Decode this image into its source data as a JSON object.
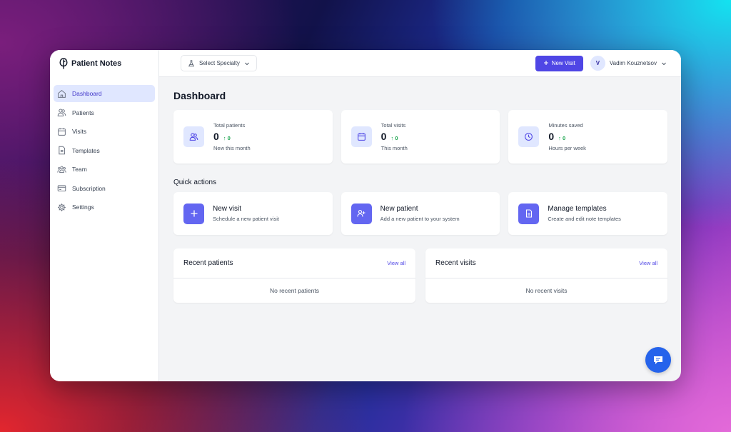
{
  "app": {
    "name": "Patient Notes",
    "accent": "#4f46e5"
  },
  "sidebar": {
    "items": [
      {
        "label": "Dashboard",
        "icon": "home-icon",
        "active": true
      },
      {
        "label": "Patients",
        "icon": "users-icon"
      },
      {
        "label": "Visits",
        "icon": "calendar-icon"
      },
      {
        "label": "Templates",
        "icon": "file-icon"
      },
      {
        "label": "Team",
        "icon": "team-icon"
      },
      {
        "label": "Subscription",
        "icon": "credit-card-icon"
      },
      {
        "label": "Settings",
        "icon": "gear-icon"
      }
    ]
  },
  "topbar": {
    "specialty_label": "Select Specialty",
    "new_visit_label": "New Visit",
    "user": {
      "initial": "V",
      "name": "Vadim Kouznetsov"
    }
  },
  "dashboard": {
    "title": "Dashboard",
    "stats": [
      {
        "label": "Total patients",
        "value": "0",
        "delta": "0",
        "sub": "New this month",
        "icon": "users-icon"
      },
      {
        "label": "Total visits",
        "value": "0",
        "delta": "0",
        "sub": "This month",
        "icon": "calendar-icon"
      },
      {
        "label": "Minutes saved",
        "value": "0",
        "delta": "0",
        "sub": "Hours per week",
        "icon": "clock-icon"
      }
    ],
    "quick_actions_title": "Quick actions",
    "quick_actions": [
      {
        "title": "New visit",
        "desc": "Schedule a new patient visit",
        "icon": "plus-icon"
      },
      {
        "title": "New patient",
        "desc": "Add a new patient to your system",
        "icon": "user-plus-icon"
      },
      {
        "title": "Manage templates",
        "desc": "Create and edit note templates",
        "icon": "document-icon"
      }
    ],
    "recent_patients": {
      "title": "Recent patients",
      "link": "View all",
      "empty": "No recent patients"
    },
    "recent_visits": {
      "title": "Recent visits",
      "link": "View all",
      "empty": "No recent visits"
    }
  },
  "chat": {
    "icon": "chat-icon",
    "color": "#2563eb"
  }
}
